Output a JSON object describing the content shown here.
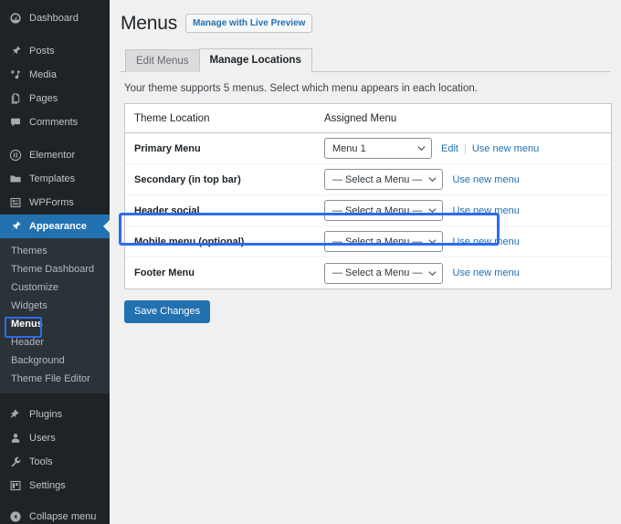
{
  "sidebar": {
    "items": [
      {
        "label": "Dashboard",
        "icon": "dashboard-icon",
        "name": "dashboard"
      },
      {
        "label": "Posts",
        "icon": "pin-icon",
        "name": "posts"
      },
      {
        "label": "Media",
        "icon": "media-icon",
        "name": "media"
      },
      {
        "label": "Pages",
        "icon": "pages-icon",
        "name": "pages"
      },
      {
        "label": "Comments",
        "icon": "comments-icon",
        "name": "comments"
      },
      {
        "label": "Elementor",
        "icon": "elementor-icon",
        "name": "elementor"
      },
      {
        "label": "Templates",
        "icon": "folder-icon",
        "name": "templates"
      },
      {
        "label": "WPForms",
        "icon": "wpforms-icon",
        "name": "wpforms"
      },
      {
        "label": "Appearance",
        "icon": "brush-icon",
        "name": "appearance"
      },
      {
        "label": "Plugins",
        "icon": "plugin-icon",
        "name": "plugins"
      },
      {
        "label": "Users",
        "icon": "user-icon",
        "name": "users"
      },
      {
        "label": "Tools",
        "icon": "wrench-icon",
        "name": "tools"
      },
      {
        "label": "Settings",
        "icon": "settings-icon",
        "name": "settings"
      },
      {
        "label": "Collapse menu",
        "icon": "collapse-icon",
        "name": "collapse-menu"
      }
    ],
    "submenu": [
      {
        "label": "Themes"
      },
      {
        "label": "Theme Dashboard"
      },
      {
        "label": "Customize"
      },
      {
        "label": "Widgets"
      },
      {
        "label": "Menus"
      },
      {
        "label": "Header"
      },
      {
        "label": "Background"
      },
      {
        "label": "Theme File Editor"
      }
    ],
    "active_item": "Appearance",
    "active_subitem": "Menus",
    "accent_color": "#2271b1",
    "highlight_color": "#2b6cec"
  },
  "header": {
    "title": "Menus",
    "live_preview_label": "Manage with Live Preview"
  },
  "tabs": [
    {
      "label": "Edit Menus",
      "active": false
    },
    {
      "label": "Manage Locations",
      "active": true
    }
  ],
  "description": "Your theme supports 5 menus. Select which menu appears in each location.",
  "table": {
    "columns": [
      "Theme Location",
      "Assigned Menu"
    ],
    "rows": [
      {
        "location": "Primary Menu",
        "selected_menu": "Menu 1",
        "links": [
          "Edit",
          "Use new menu"
        ],
        "highlighted": false
      },
      {
        "location": "Secondary (in top bar)",
        "selected_menu": "— Select a Menu —",
        "links": [
          "Use new menu"
        ],
        "highlighted": false
      },
      {
        "location": "Header social",
        "selected_menu": "— Select a Menu —",
        "links": [
          "Use new menu"
        ],
        "highlighted": false
      },
      {
        "location": "Mobile menu (optional)",
        "selected_menu": "— Select a Menu —",
        "links": [
          "Use new menu"
        ],
        "highlighted": true
      },
      {
        "location": "Footer Menu",
        "selected_menu": "— Select a Menu —",
        "links": [
          "Use new menu"
        ],
        "highlighted": false
      }
    ]
  },
  "save_button_label": "Save Changes"
}
